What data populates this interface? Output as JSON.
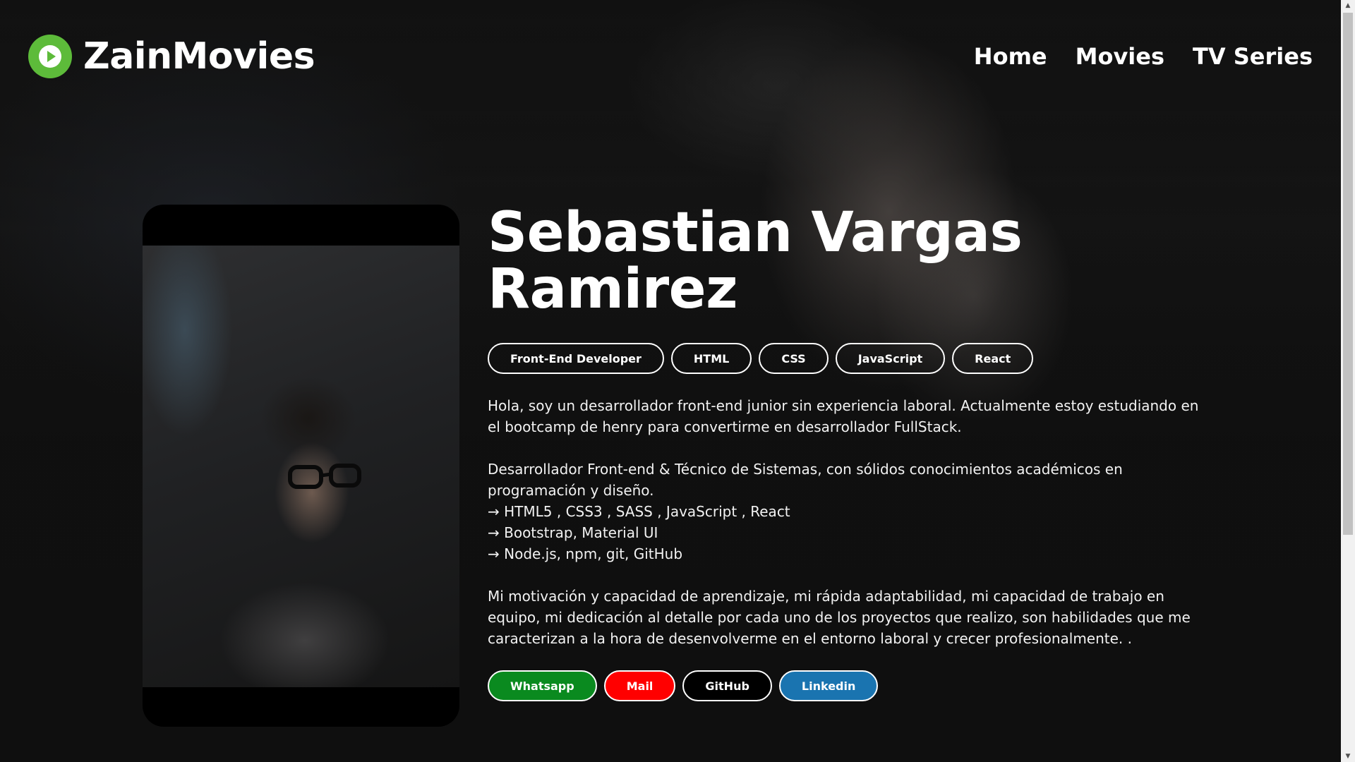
{
  "header": {
    "brand": "ZainMovies",
    "nav": [
      "Home",
      "Movies",
      "TV Series"
    ]
  },
  "profile": {
    "name": "Sebastian Vargas Ramirez",
    "tags": [
      "Front-End Developer",
      "HTML",
      "CSS",
      "JavaScript",
      "React"
    ],
    "bio": {
      "intro": "Hola, soy un desarrollador front-end junior sin experiencia laboral. Actualmente estoy estudiando en el bootcamp de henry para convertirme en desarrollador FullStack.",
      "skills_intro": "Desarrollador Front-end & Técnico de Sistemas, con sólidos conocimientos académicos en programación y diseño.",
      "skills": [
        "→ HTML5 , CSS3 , SASS , JavaScript , React",
        "→ Bootstrap, Material UI",
        "→ Node.js, npm, git, GitHub"
      ],
      "motivation": "Mi motivación y capacidad de aprendizaje, mi rápida adaptabilidad, mi capacidad de trabajo en equipo, mi dedicación al detalle por cada uno de los proyectos que realizo, son habilidades que me caracterizan a la hora de desenvolverme en el entorno laboral y crecer profesionalmente. ."
    },
    "contacts": {
      "whatsapp": "Whatsapp",
      "mail": "Mail",
      "github": "GitHub",
      "linkedin": "Linkedin"
    }
  },
  "colors": {
    "brand_green": "#5dbb3a",
    "whatsapp": "#0a8a1f",
    "mail": "#ff0000",
    "github": "#000000",
    "linkedin": "#1a74b0"
  },
  "icons": {
    "logo": "play-circle-icon"
  }
}
